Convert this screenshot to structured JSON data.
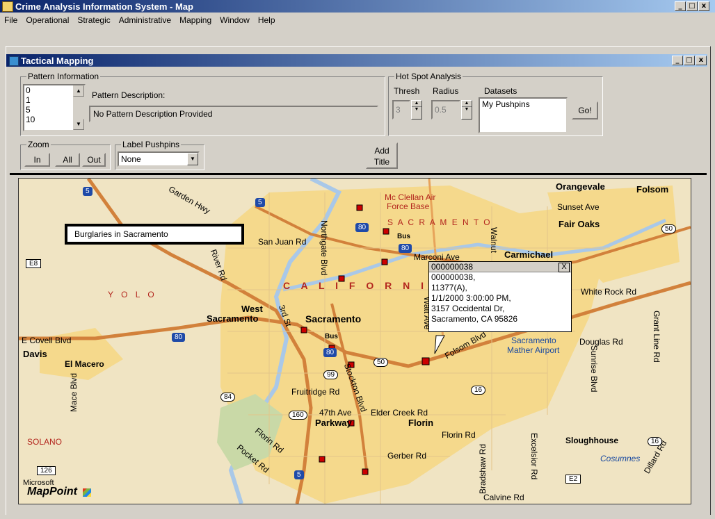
{
  "app": {
    "title": "Crime Analysis Information System - Map",
    "window_buttons": [
      "_",
      "□",
      "x"
    ]
  },
  "menu": [
    "File",
    "Operational",
    "Strategic",
    "Administrative",
    "Mapping",
    "Window",
    "Help"
  ],
  "child": {
    "title": "Tactical Mapping",
    "window_buttons": [
      "_",
      "□",
      "x"
    ]
  },
  "pattern": {
    "legend": "Pattern Information",
    "items": [
      "0",
      "1",
      "5",
      "10"
    ],
    "description_label": "Pattern Description:",
    "description_value": "No Pattern Description Provided"
  },
  "hotspot": {
    "legend": "Hot Spot Analysis",
    "thresh_label": "Thresh",
    "radius_label": "Radius",
    "datasets_label": "Datasets",
    "thresh_value": "3",
    "radius_value": "0.5",
    "datasets_item": "My Pushpins",
    "go_label": "Go!"
  },
  "zoom": {
    "legend": "Zoom",
    "in_label": "In",
    "all_label": "All",
    "out_label": "Out"
  },
  "label_pushpins": {
    "legend": "Label Pushpins",
    "selected": "None"
  },
  "add_title": {
    "line1": "Add",
    "line2": "Title"
  },
  "map": {
    "title_box": "Burglaries in Sacramento",
    "colors": {
      "land": "#f0e4c3",
      "urban": "#f5d98c",
      "water": "#a9c8e8",
      "green": "#c9d9a7",
      "highway": "#d2813b",
      "pushpin": "#cc0000"
    },
    "labels": [
      "Orangevale",
      "Folsom",
      "Mc Clellan Air",
      "Force Base",
      "Sunset Ave",
      "Fair Oaks",
      "S A C R A M E N T O",
      "San Juan Rd",
      "Carmichael",
      "Marconi Ave",
      "White Rock Rd",
      "Y O L O",
      "C A L I F O R N I A",
      "West",
      "Sacramento",
      "Sacramento",
      "E Covell Blvd",
      "Davis",
      "El Macero",
      "Sacramento",
      "Mather Airport",
      "Douglas Rd",
      "Fruitridge Rd",
      "47th Ave",
      "Elder Creek Rd",
      "Parkway",
      "Florin",
      "Florin Rd",
      "Sloughhouse",
      "Cosumnes",
      "SOLANO",
      "Gerber Rd",
      "Calvine Rd",
      "Northgate Blvd",
      "Walnut",
      "Stockton Blvd",
      "Folsom Blvd",
      "Watt Ave",
      "Mace Blvd",
      "Sunrise Blvd",
      "Grant Line Rd",
      "Excelsior Rd",
      "Bradshaw Rd",
      "Dillard Rd",
      "Garden Hwy",
      "Pocket Rd",
      "Florin Rd",
      "River Rd",
      "3rd St",
      "Bus",
      "Bus"
    ],
    "shields": [
      "5",
      "5",
      "80",
      "80",
      "80",
      "80",
      "80",
      "50",
      "50",
      "99",
      "84",
      "16",
      "16",
      "160",
      "5",
      "126",
      "E8",
      "E2"
    ],
    "brand_top": "Microsoft",
    "brand": "MapPoint"
  },
  "popup": {
    "header": "000000038",
    "close": "X",
    "lines": [
      "000000038,",
      "11377(A),",
      "1/1/2000 3:00:00 PM,",
      "3157 Occidental Dr,",
      "Sacramento, CA 95826"
    ]
  }
}
